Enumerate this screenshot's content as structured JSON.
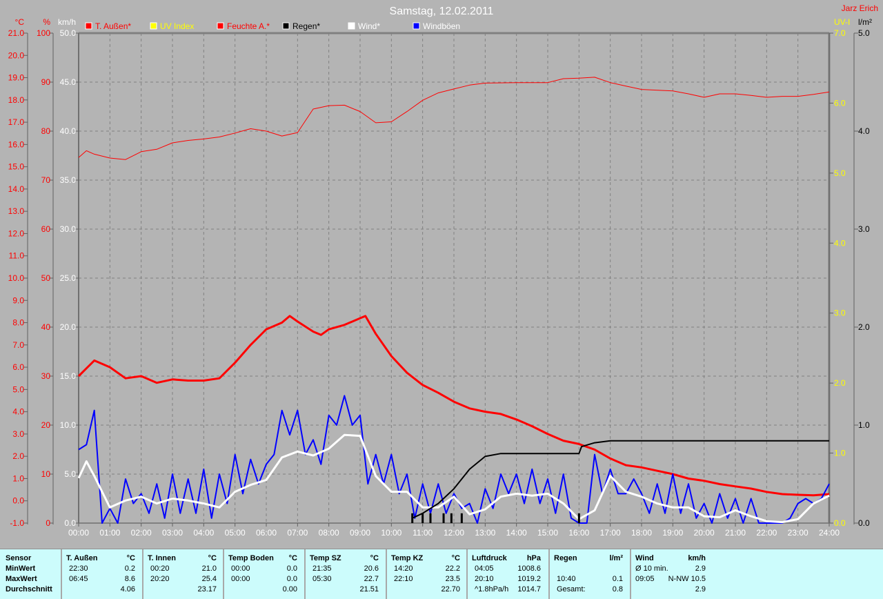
{
  "header": {
    "title": "Samstag, 12.02.2011",
    "user": "Jarz Erich"
  },
  "chart_data": {
    "type": "line",
    "title": "Samstag, 12.02.2011",
    "x_unit": "hour",
    "xlim": [
      0,
      24
    ],
    "x_ticks": [
      "00:00",
      "01:00",
      "02:00",
      "03:00",
      "04:00",
      "05:00",
      "06:00",
      "07:00",
      "08:00",
      "09:00",
      "10:00",
      "11:00",
      "12:00",
      "13:00",
      "14:00",
      "15:00",
      "16:00",
      "17:00",
      "18:00",
      "19:00",
      "20:00",
      "21:00",
      "22:00",
      "23:00",
      "24:00"
    ],
    "axes": {
      "temp": {
        "label": "°C",
        "range": [
          -1,
          21
        ],
        "step": 1,
        "color": "#ff0000",
        "ticks": [
          "-1.0",
          "0.0",
          "1.0",
          "2.0",
          "3.0",
          "4.0",
          "5.0",
          "6.0",
          "7.0",
          "8.0",
          "9.0",
          "10.0",
          "11.0",
          "12.0",
          "13.0",
          "14.0",
          "15.0",
          "16.0",
          "17.0",
          "18.0",
          "19.0",
          "20.0",
          "21.0"
        ]
      },
      "humidity": {
        "label": "%",
        "range": [
          0,
          100
        ],
        "step": 10,
        "color": "#ff0000",
        "ticks": [
          "0",
          "10",
          "20",
          "30",
          "40",
          "50",
          "60",
          "70",
          "80",
          "90",
          "100"
        ]
      },
      "wind": {
        "label": "km/h",
        "range": [
          0,
          50
        ],
        "step": 5,
        "color": "#ffffff",
        "ticks": [
          "0.0",
          "5.0",
          "10.0",
          "15.0",
          "20.0",
          "25.0",
          "30.0",
          "35.0",
          "40.0",
          "45.0",
          "50.0"
        ]
      },
      "uv": {
        "label": "UV-I",
        "range": [
          0,
          7
        ],
        "step": 1,
        "color": "#ffff00",
        "ticks": [
          "0.0",
          "1.0",
          "2.0",
          "3.0",
          "4.0",
          "5.0",
          "6.0",
          "7.0"
        ]
      },
      "rain": {
        "label": "l/m²",
        "range": [
          0,
          5
        ],
        "step": 1,
        "color": "#000000",
        "ticks": [
          "0.0",
          "1.0",
          "2.0",
          "3.0",
          "4.0",
          "5.0"
        ]
      }
    },
    "legend": [
      {
        "name": "T. Außen*",
        "color": "#ff0000",
        "text_color": "#ff0000"
      },
      {
        "name": "UV Index",
        "color": "#ffff00",
        "text_color": "#ffff00"
      },
      {
        "name": "Feuchte A.*",
        "color": "#ff0000",
        "text_color": "#ff0000"
      },
      {
        "name": "Regen*",
        "color": "#000000",
        "text_color": "#000000"
      },
      {
        "name": "Wind*",
        "color": "#ffffff",
        "text_color": "#ffffff"
      },
      {
        "name": "Windböen",
        "color": "#0000ff",
        "text_color": "#ffffff"
      }
    ],
    "series": [
      {
        "name": "T. Außen*",
        "axis": "temp",
        "color": "#ff0000",
        "width": 3,
        "x": [
          0,
          0.5,
          1,
          1.5,
          2,
          2.5,
          3,
          3.5,
          4,
          4.5,
          5,
          5.5,
          6,
          6.5,
          6.75,
          7,
          7.5,
          7.75,
          8,
          8.5,
          9,
          9.17,
          9.5,
          10,
          10.5,
          11,
          11.5,
          12,
          12.5,
          13,
          13.5,
          14,
          14.5,
          15,
          15.5,
          16,
          16.5,
          17,
          17.5,
          18,
          18.5,
          19,
          19.5,
          20,
          20.5,
          21,
          21.5,
          22,
          22.5,
          23,
          23.5,
          24
        ],
        "y": [
          5.6,
          6.3,
          6.0,
          5.5,
          5.6,
          5.3,
          5.45,
          5.4,
          5.4,
          5.5,
          6.2,
          7.0,
          7.7,
          8.0,
          8.3,
          8.05,
          7.6,
          7.45,
          7.7,
          7.9,
          8.2,
          8.3,
          7.5,
          6.5,
          5.75,
          5.2,
          4.85,
          4.45,
          4.15,
          4.0,
          3.9,
          3.65,
          3.35,
          3.0,
          2.7,
          2.55,
          2.3,
          1.9,
          1.6,
          1.5,
          1.35,
          1.2,
          1.0,
          0.9,
          0.75,
          0.65,
          0.55,
          0.4,
          0.3,
          0.27,
          0.25,
          0.3
        ]
      },
      {
        "name": "Feuchte A.*",
        "axis": "humidity",
        "color": "#ff0000",
        "width": 1,
        "x": [
          0,
          0.25,
          0.5,
          1,
          1.5,
          2,
          2.5,
          3,
          3.5,
          4,
          4.5,
          5,
          5.5,
          6,
          6.5,
          7,
          7.5,
          8,
          8.5,
          9,
          9.5,
          10,
          10.5,
          11,
          11.5,
          12,
          12.5,
          13,
          14,
          15,
          15.5,
          16,
          16.5,
          17,
          17.5,
          18,
          19,
          19.5,
          20,
          20.5,
          21,
          21.5,
          22,
          22.5,
          23,
          23.5,
          24
        ],
        "y": [
          74.6,
          76,
          75.3,
          74.5,
          74.2,
          75.8,
          76.3,
          77.6,
          78.1,
          78.4,
          78.8,
          79.6,
          80.5,
          80.0,
          79.0,
          79.7,
          84.5,
          85.2,
          85.3,
          84.0,
          81.7,
          81.9,
          84.0,
          86.3,
          87.8,
          88.6,
          89.4,
          89.8,
          89.9,
          89.9,
          90.7,
          90.8,
          91.0,
          89.9,
          89.2,
          88.5,
          88.2,
          87.6,
          86.9,
          87.6,
          87.6,
          87.3,
          86.9,
          87.1,
          87.1,
          87.5,
          88.0
        ]
      },
      {
        "name": "Windböen",
        "axis": "wind",
        "color": "#0000ff",
        "width": 2,
        "step_hours": 0.25,
        "y": [
          7.5,
          8,
          11.5,
          0,
          1.5,
          0,
          4.5,
          2,
          3,
          1,
          4,
          0.5,
          5,
          1,
          4.5,
          1,
          5.5,
          0.5,
          5,
          2,
          7,
          3,
          6.5,
          4,
          6,
          7,
          11.5,
          9,
          11.5,
          7,
          8.5,
          6,
          11,
          10,
          13,
          10,
          11,
          4,
          7,
          4,
          7,
          3,
          5,
          0.5,
          4,
          1,
          4,
          1,
          3,
          1.5,
          2,
          0,
          3.5,
          1.5,
          5,
          3,
          5,
          2,
          5.5,
          2,
          4.5,
          1,
          5,
          0.5,
          0,
          0,
          7,
          3,
          5.5,
          3,
          3,
          4.5,
          3,
          1,
          4,
          1,
          5,
          1,
          4,
          0.5,
          2,
          0,
          3,
          0.5,
          2.5,
          0,
          2.5,
          0,
          0,
          0,
          0,
          0.5,
          2,
          2.5,
          2,
          2.5,
          4
        ]
      },
      {
        "name": "Wind*",
        "axis": "wind",
        "color": "#ffffff",
        "width": 3,
        "x": [
          0,
          0.25,
          0.5,
          1,
          1.5,
          2,
          2.5,
          3,
          3.5,
          4,
          4.5,
          5,
          5.5,
          6,
          6.5,
          7,
          7.5,
          8,
          8.5,
          9,
          9.5,
          10,
          10.5,
          11,
          11.5,
          12,
          12.5,
          13,
          13.5,
          14,
          14.5,
          15,
          15.5,
          16,
          16.5,
          17,
          17.5,
          18,
          18.5,
          19,
          19.5,
          20,
          20.5,
          21,
          21.5,
          22,
          22.5,
          23,
          23.5,
          24
        ],
        "y": [
          4.6,
          6.3,
          4.8,
          1.6,
          2.3,
          2.7,
          2.0,
          2.5,
          2.3,
          2.0,
          1.6,
          3.2,
          3.9,
          4.4,
          6.7,
          7.3,
          6.9,
          7.6,
          9.0,
          8.9,
          4.8,
          3.2,
          3.2,
          1.6,
          1.6,
          2.7,
          0.9,
          1.4,
          2.7,
          3.0,
          2.8,
          3.0,
          2.0,
          0.4,
          1.3,
          4.8,
          3.2,
          2.7,
          2.0,
          1.6,
          1.6,
          0.7,
          0.6,
          1.3,
          0.7,
          0.2,
          0.1,
          0.4,
          2.0,
          2.8
        ]
      },
      {
        "name": "Regen*",
        "axis": "rain",
        "color": "#000000",
        "width": 2,
        "x": [
          10.67,
          11,
          11.5,
          12,
          12.5,
          13,
          13.5,
          16,
          16.08,
          16.5,
          17,
          24
        ],
        "y": [
          0.05,
          0.1,
          0.2,
          0.35,
          0.55,
          0.68,
          0.71,
          0.71,
          0.78,
          0.82,
          0.84,
          0.84
        ],
        "bars_x": [
          10.67,
          11.0,
          11.25,
          11.67,
          11.92,
          12.25,
          16.0
        ],
        "bars_y": [
          0.1,
          0.1,
          0.1,
          0.1,
          0.1,
          0.1,
          0.1
        ]
      }
    ],
    "grid": true
  },
  "stats": {
    "label_col": {
      "header": "Sensor",
      "rows": [
        "MinWert",
        "MaxWert",
        "Durchschnitt"
      ]
    },
    "columns": [
      {
        "title": "T. Außen",
        "unit": "°C",
        "rows": [
          [
            "22:30",
            "0.2"
          ],
          [
            "06:45",
            "8.6"
          ],
          [
            "",
            "4.06"
          ]
        ]
      },
      {
        "title": "T. Innen",
        "unit": "°C",
        "rows": [
          [
            "00:20",
            "21.0"
          ],
          [
            "20:20",
            "25.4"
          ],
          [
            "",
            "23.17"
          ]
        ]
      },
      {
        "title": "Temp Boden",
        "unit": "°C",
        "rows": [
          [
            "00:00",
            "0.0"
          ],
          [
            "00:00",
            "0.0"
          ],
          [
            "",
            "0.00"
          ]
        ]
      },
      {
        "title": "Temp SZ",
        "unit": "°C",
        "rows": [
          [
            "21:35",
            "20.6"
          ],
          [
            "05:30",
            "22.7"
          ],
          [
            "",
            "21.51"
          ]
        ]
      },
      {
        "title": "Temp KZ",
        "unit": "°C",
        "rows": [
          [
            "14:20",
            "22.2"
          ],
          [
            "22:10",
            "23.5"
          ],
          [
            "",
            "22.70"
          ]
        ]
      },
      {
        "title": "Luftdruck",
        "unit": "hPa",
        "rows": [
          [
            "04:05",
            "1008.6"
          ],
          [
            "20:10",
            "1019.2"
          ],
          [
            "^1.8hPa/h",
            "1014.7"
          ]
        ]
      },
      {
        "title": "Regen",
        "unit": "l/m²",
        "rows": [
          [
            "",
            ""
          ],
          [
            "10:40",
            "0.1"
          ],
          [
            "Gesamt:",
            "0.8"
          ]
        ]
      },
      {
        "title": "Wind",
        "unit": "km/h",
        "rows": [
          [
            "Ø 10 min.",
            "2.9"
          ],
          [
            "09:05",
            "N-NW 10.5"
          ],
          [
            "",
            "2.9"
          ]
        ]
      }
    ]
  }
}
